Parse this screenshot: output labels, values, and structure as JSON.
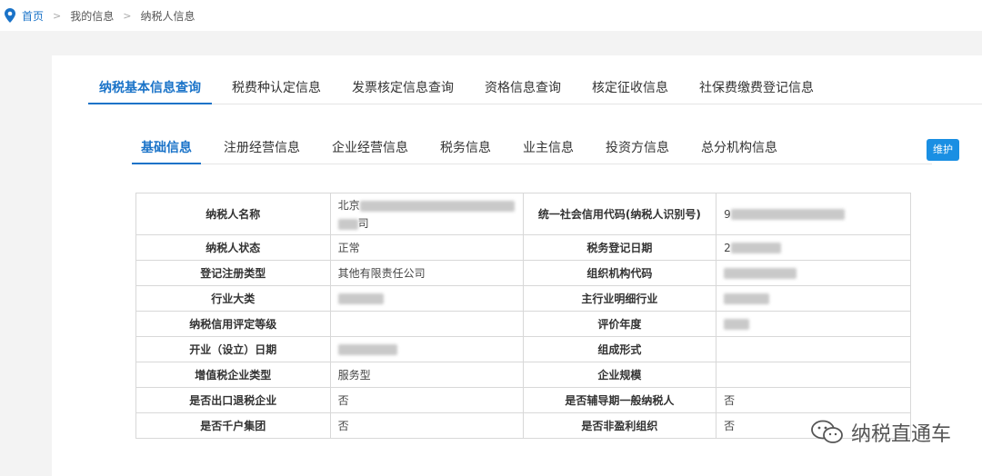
{
  "breadcrumb": {
    "home": "首页",
    "sep": ">",
    "item1": "我的信息",
    "item2": "纳税人信息"
  },
  "top_tabs": [
    "纳税基本信息查询",
    "税费种认定信息",
    "发票核定信息查询",
    "资格信息查询",
    "核定征收信息",
    "社保费缴费登记信息"
  ],
  "sub_tabs": [
    "基础信息",
    "注册经营信息",
    "企业经营信息",
    "税务信息",
    "业主信息",
    "投资方信息",
    "总分机构信息"
  ],
  "maintain_button": "维护",
  "table": {
    "r0": {
      "l1": "纳税人名称",
      "v1a": "北京",
      "v1b": "司",
      "l2": "统一社会信用代码(纳税人识别号)",
      "v2": "9"
    },
    "r1": {
      "l1": "纳税人状态",
      "v1": "正常",
      "l2": "税务登记日期",
      "v2": "2"
    },
    "r2": {
      "l1": "登记注册类型",
      "v1": "其他有限责任公司",
      "l2": "组织机构代码",
      "v2": ""
    },
    "r3": {
      "l1": "行业大类",
      "v1": "",
      "l2": "主行业明细行业",
      "v2": ""
    },
    "r4": {
      "l1": "纳税信用评定等级",
      "v1": "",
      "l2": "评价年度",
      "v2": ""
    },
    "r5": {
      "l1": "开业（设立）日期",
      "v1": "",
      "l2": "组成形式",
      "v2": ""
    },
    "r6": {
      "l1": "增值税企业类型",
      "v1": "服务型",
      "l2": "企业规模",
      "v2": ""
    },
    "r7": {
      "l1": "是否出口退税企业",
      "v1": "否",
      "l2": "是否辅导期一般纳税人",
      "v2": "否"
    },
    "r8": {
      "l1": "是否千户集团",
      "v1": "否",
      "l2": "是否非盈利组织",
      "v2": "否"
    }
  },
  "watermark": "纳税直通车",
  "icons": {
    "breadcrumb": "location-pin-icon",
    "watermark": "wechat-icon"
  },
  "colors": {
    "accent": "#1a73c8",
    "button": "#1a8fe3"
  }
}
